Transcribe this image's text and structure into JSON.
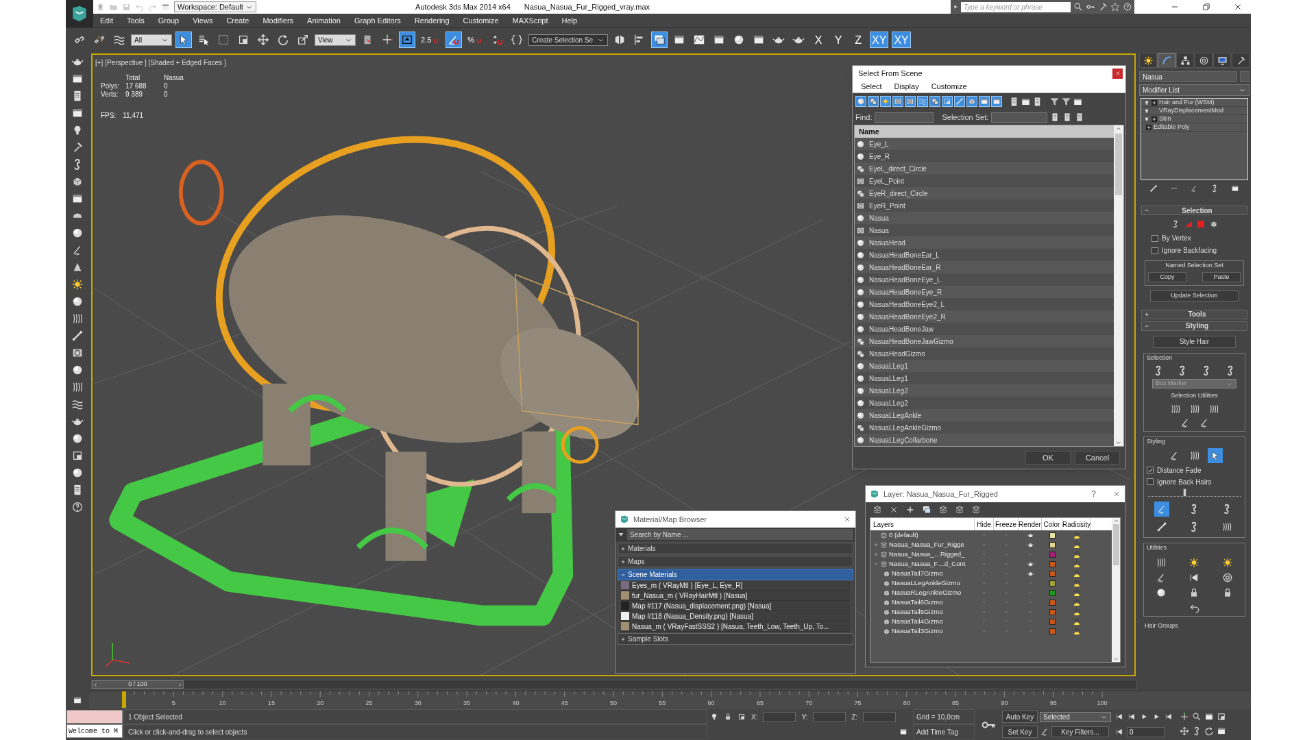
{
  "window": {
    "workspace": "Workspace: Default",
    "app_title": "Autodesk 3ds Max  2014 x64",
    "file_name": "Nasua_Nasua_Fur_Rigged_vray.max",
    "search": {
      "placeholder": "Type a keyword or phrase"
    }
  },
  "menu": [
    "Edit",
    "Tools",
    "Group",
    "Views",
    "Create",
    "Modifiers",
    "Animation",
    "Graph Editors",
    "Rendering",
    "Customize",
    "MAXScript",
    "Help"
  ],
  "main_toolbar": [
    {
      "kind": "icon",
      "selected": false
    },
    {
      "kind": "icon",
      "selected": false
    },
    {
      "kind": "icon",
      "selected": false
    },
    {
      "kind": "dropdown",
      "value": "All"
    },
    {
      "kind": "icon",
      "selected": true
    },
    {
      "kind": "icon",
      "selected": false
    },
    {
      "kind": "icon",
      "selected": false
    },
    {
      "kind": "icon",
      "selected": false
    },
    {
      "kind": "icon",
      "selected": false
    },
    {
      "kind": "icon",
      "selected": false
    },
    {
      "kind": "icon",
      "selected": false
    },
    {
      "kind": "dropdown",
      "value": "View"
    },
    {
      "kind": "icon",
      "selected": false
    },
    {
      "kind": "icon",
      "selected": false
    },
    {
      "kind": "icon",
      "selected": true
    },
    {
      "kind": "snap",
      "label": "2.5",
      "selected": false
    },
    {
      "kind": "icon",
      "selected": true
    },
    {
      "kind": "snap",
      "label": "%",
      "selected": false
    },
    {
      "kind": "icon",
      "selected": false
    },
    {
      "kind": "icon",
      "selected": false
    },
    {
      "kind": "dropdown",
      "value": "Create Selection Se"
    },
    {
      "kind": "icon",
      "selected": false
    },
    {
      "kind": "icon",
      "selected": false
    },
    {
      "kind": "icon",
      "selected": true
    },
    {
      "kind": "icon",
      "selected": false
    },
    {
      "kind": "icon",
      "selected": false
    },
    {
      "kind": "icon",
      "selected": false
    },
    {
      "kind": "icon",
      "selected": false
    },
    {
      "kind": "icon",
      "selected": false
    },
    {
      "kind": "icon",
      "selected": false
    },
    {
      "kind": "icon",
      "selected": false
    },
    {
      "kind": "axis",
      "label": "X",
      "selected": false
    },
    {
      "kind": "axis",
      "label": "Y",
      "selected": false
    },
    {
      "kind": "axis",
      "label": "Z",
      "selected": false
    },
    {
      "kind": "axis",
      "label": "XY",
      "selected": true
    },
    {
      "kind": "axis",
      "label": "XY",
      "selected": true
    }
  ],
  "viewport": {
    "label": "[+] [Perspective ] [Shaded + Edged Faces ]",
    "active": true,
    "stats": {
      "header": [
        "Total",
        "Nasua"
      ],
      "rows": [
        {
          "label": "Polys:",
          "total": "17 688",
          "object": "0"
        },
        {
          "label": "Verts:",
          "total": "9 389",
          "object": "0"
        }
      ],
      "fps_label": "FPS:",
      "fps": "11,471"
    }
  },
  "select_from_scene": {
    "title": "Select From Scene",
    "menu": [
      "Select",
      "Display",
      "Customize"
    ],
    "filters": [
      {
        "on": true
      },
      {
        "on": true
      },
      {
        "on": true
      },
      {
        "on": true
      },
      {
        "on": true
      },
      {
        "on": true
      },
      {
        "on": true
      },
      {
        "on": true
      },
      {
        "on": true
      },
      {
        "on": true
      },
      {
        "on": true
      },
      {
        "on": true
      }
    ],
    "find_label": "Find:",
    "selection_set_label": "Selection Set:",
    "column": "Name",
    "rows": [
      {
        "kind": "geometry",
        "name": "Eye_L"
      },
      {
        "kind": "geometry",
        "name": "Eye_R"
      },
      {
        "kind": "shape",
        "name": "EyeL_direct_Circle"
      },
      {
        "kind": "helper",
        "name": "EyeL_Point"
      },
      {
        "kind": "shape",
        "name": "EyeR_direct_Circle"
      },
      {
        "kind": "helper",
        "name": "EyeR_Point"
      },
      {
        "kind": "geometry",
        "name": "Nasua"
      },
      {
        "kind": "helper",
        "name": "Nasua"
      },
      {
        "kind": "geometry",
        "name": "NasuaHead"
      },
      {
        "kind": "geometry",
        "name": "NasuaHeadBoneEar_L"
      },
      {
        "kind": "geometry",
        "name": "NasuaHeadBoneEar_R"
      },
      {
        "kind": "geometry",
        "name": "NasuaHeadBoneEye_L"
      },
      {
        "kind": "geometry",
        "name": "NasuaHeadBoneEye_R"
      },
      {
        "kind": "geometry",
        "name": "NasuaHeadBoneEye2_L"
      },
      {
        "kind": "geometry",
        "name": "NasuaHeadBoneEye2_R"
      },
      {
        "kind": "geometry",
        "name": "NasuaHeadBoneJaw"
      },
      {
        "kind": "shape",
        "name": "NasuaHeadBoneJawGizmo"
      },
      {
        "kind": "shape",
        "name": "NasuaHeadGizmo"
      },
      {
        "kind": "geometry",
        "name": "NasuaLLeg1"
      },
      {
        "kind": "geometry",
        "name": "NasuaLLeg1"
      },
      {
        "kind": "geometry",
        "name": "NasuaLLeg2"
      },
      {
        "kind": "geometry",
        "name": "NasuaLLeg2"
      },
      {
        "kind": "geometry",
        "name": "NasuaLLegAnkle"
      },
      {
        "kind": "shape",
        "name": "NasuaLLegAnkleGizmo"
      },
      {
        "kind": "geometry",
        "name": "NasuaLLegCollarbone"
      }
    ],
    "buttons": [
      "OK",
      "Cancel"
    ]
  },
  "material_browser": {
    "title": "Material/Map Browser",
    "search": {
      "placeholder": "Search by Name ..."
    },
    "sections": [
      {
        "label": "Materials",
        "expanded": false,
        "selected": false
      },
      {
        "label": "Maps",
        "expanded": false,
        "selected": false
      },
      {
        "label": "Scene Materials",
        "expanded": true,
        "selected": true,
        "items": [
          {
            "kind": "checker",
            "text": "Eyes_m  ( VRayMtl ) [Eye_L, Eye_R]"
          },
          {
            "kind": "fur",
            "text": "fur_Nasua_m  ( VRayHairMtl ) [Nasua]"
          },
          {
            "kind": "dark",
            "text": "Map #117 (Nasua_displacement.png)  [Nasua]"
          },
          {
            "kind": "mask",
            "text": "Map #118 (Nasua_Density.png)  [Nasua]"
          },
          {
            "kind": "fur",
            "text": "Nasua_m  ( VRayFastSSS2 )  [Nasua, Teeth_Low, Teeth_Up, To..."
          }
        ]
      },
      {
        "label": "Sample Slots",
        "expanded": false,
        "selected": false
      }
    ]
  },
  "layer_dialog": {
    "title": "Layer: Nasua_Nasua_Fur_Rigged",
    "help": "?",
    "columns": [
      "Layers",
      "Hide",
      "Freeze",
      "Render",
      "Color",
      "Radiosity"
    ],
    "layers": [
      {
        "name": "0 (default)",
        "render": true,
        "color": "#e6e6a0"
      },
      {
        "name": "Nasua_Nasua_Fur_Rigge",
        "render": true,
        "color": "#e6d890",
        "expanded": false
      },
      {
        "name": "Nasua_Nasua_…Rigged_",
        "render": false,
        "color": "#a01e78",
        "expanded": false
      },
      {
        "name": "Nasua_Nasua_F…d_Cont",
        "render": true,
        "color": "#c8581a",
        "expanded": true,
        "children": [
          {
            "name": "NasuaTail7Gizmo",
            "render": true,
            "color": "#c8581a"
          },
          {
            "name": "NasuaLLegAnkleGizmo",
            "render": false,
            "color": "#a0a03c"
          },
          {
            "name": "NasuaRLegAnkleGizmo",
            "render": false,
            "color": "#1e9a1e"
          },
          {
            "name": "NasuaTail6Gizmo",
            "render": false,
            "color": "#c8581a"
          },
          {
            "name": "NasuaTail5Gizmo",
            "render": false,
            "color": "#c8581a"
          },
          {
            "name": "NasuaTail4Gizmo",
            "render": false,
            "color": "#c8581a"
          },
          {
            "name": "NasuaTail3Gizmo",
            "render": false,
            "color": "#c8581a"
          }
        ]
      }
    ]
  },
  "command_panel": {
    "tabs": [
      {
        "selected": false
      },
      {
        "selected": true
      },
      {
        "selected": false
      },
      {
        "selected": false
      },
      {
        "selected": false
      },
      {
        "selected": false
      }
    ],
    "object_name": "Nasua",
    "modifier_list": "Modifier List",
    "stack": [
      {
        "kind": "modifier",
        "label": "Hair and Fur (WSM)",
        "expandable": true
      },
      {
        "kind": "modifier",
        "label": "VRayDisplacementMod",
        "expandable": false
      },
      {
        "kind": "modifier",
        "label": "Skin",
        "expandable": true
      },
      {
        "kind": "base",
        "label": "Editable Poly",
        "expandable": true
      }
    ],
    "selection": {
      "title": "Selection",
      "expanded": true,
      "checks": [
        {
          "label": "By Vertex",
          "checked": false
        },
        {
          "label": "Ignore Backfacing",
          "checked": false
        }
      ],
      "group": "Named Selection Set",
      "buttons": [
        "Copy",
        "Paste"
      ],
      "update": "Update Selection"
    },
    "tools": {
      "title": "Tools",
      "expanded": false
    },
    "styling": {
      "title": "Styling",
      "expanded": true,
      "style_button": "Style Hair",
      "selection_group": "Selection",
      "dropdown": "Box Marker",
      "utilities_label": "Selection Utilities",
      "styling_group": "Styling",
      "styling_tools": [
        {
          "selected": false
        },
        {
          "selected": false
        },
        {
          "selected": true
        }
      ],
      "checks": [
        {
          "label": "Distance Fade",
          "checked": true
        },
        {
          "label": "Ignore Back Hairs",
          "checked": false
        }
      ],
      "slider": {
        "level": 0.38
      },
      "brush_tools": [
        {
          "selected": true
        },
        {
          "selected": false
        },
        {
          "selected": false
        },
        {
          "selected": false
        },
        {
          "selected": false
        },
        {
          "selected": false
        }
      ],
      "utilities_group": "Utilities",
      "hair_groups": "Hair Groups"
    }
  },
  "timeline": {
    "frame": "0 / 100",
    "level": 0
  },
  "ruler": [
    "5",
    "10",
    "15",
    "20",
    "25",
    "30",
    "35",
    "40",
    "45",
    "50",
    "55",
    "60",
    "65",
    "70",
    "75",
    "80",
    "85",
    "90",
    "95",
    "100"
  ],
  "status": {
    "listener": "Welcome to M",
    "selection": "1 Object Selected",
    "prompt": "Click or click-and-drag to select objects",
    "coords": [
      "X:",
      "Y:",
      "Z:"
    ],
    "grid": "Grid = 10,0cm",
    "add_time_tag": "Add Time Tag",
    "auto_key": "Auto Key",
    "set_key": "Set Key",
    "key_mode": "Selected",
    "key_filters": "Key Filters...",
    "frame": "0"
  }
}
